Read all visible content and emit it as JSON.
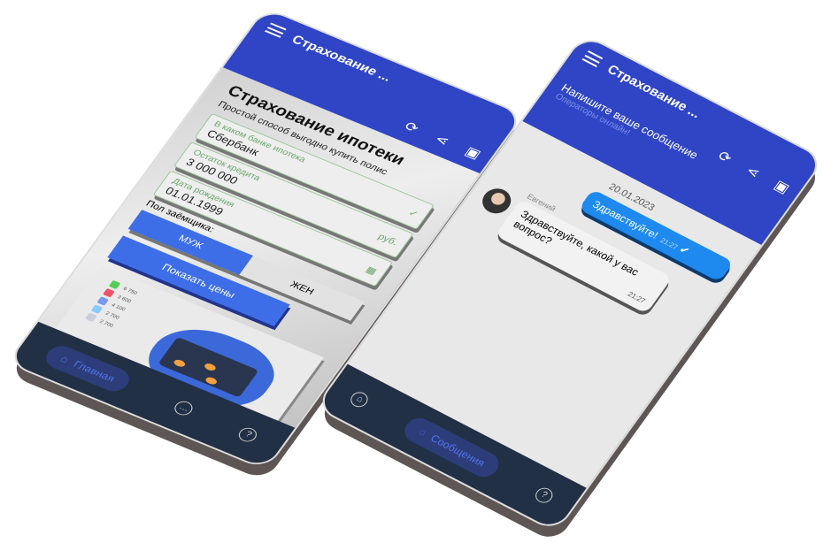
{
  "left_phone": {
    "header": {
      "title": "Страхование ...",
      "icons": [
        "menu-icon",
        "refresh-icon",
        "share-icon",
        "qr-code-icon"
      ]
    },
    "page_title": "Страхование ипотеки",
    "subtitle": "Простой способ выгодно купить полис",
    "fields": [
      {
        "label": "В каком банке ипотека",
        "value": "Сбербанк",
        "suffix": "✓"
      },
      {
        "label": "Остаток кредита",
        "value": "3 000 000",
        "suffix": "руб."
      },
      {
        "label": "Дата рождения",
        "value": "01.01.1999",
        "suffix": "▦"
      }
    ],
    "gender_label": "Пол заёмщика:",
    "gender": {
      "male": "МУЖ",
      "female": "ЖЕН",
      "selected": "МУЖ"
    },
    "show_prices": "Показать цены",
    "illustration_prices": [
      "6 750",
      "3 600",
      "4 100",
      "2 700",
      "2 700"
    ],
    "nav": {
      "home": "Главная",
      "active": "home"
    }
  },
  "right_phone": {
    "header": {
      "title": "Страхование ...",
      "prompt": "Напишите ваше сообщение",
      "status": "Операторы онлайн!"
    },
    "date": "20.01.2023",
    "messages": [
      {
        "dir": "out",
        "text": "Здравствуйте!",
        "time": "21:27"
      },
      {
        "dir": "in",
        "author": "Евгений",
        "text": "Здравствуйте, какой у вас вопрос?",
        "time": "21:27"
      }
    ],
    "nav": {
      "messages": "Сообщения",
      "active": "messages"
    }
  },
  "colors": {
    "primary": "#2f45c6",
    "button": "#3d6ee8",
    "nav": "#223046",
    "bubble": "#1e8af0"
  }
}
